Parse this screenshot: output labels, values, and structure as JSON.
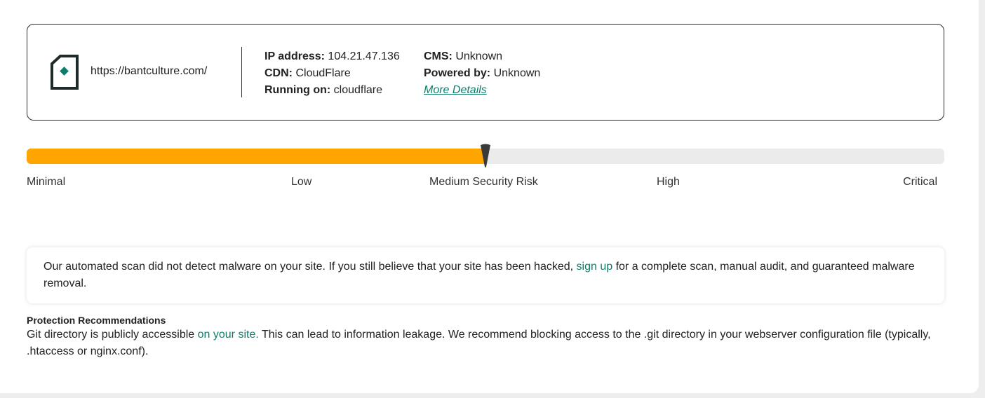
{
  "site": {
    "url": "https://bantculture.com/",
    "ip_label": "IP address:",
    "ip_value": "104.21.47.136",
    "cdn_label": "CDN:",
    "cdn_value": "CloudFlare",
    "running_label": "Running on:",
    "running_value": "cloudflare",
    "cms_label": "CMS:",
    "cms_value": "Unknown",
    "powered_label": "Powered by:",
    "powered_value": "Unknown",
    "more_details": "More Details",
    "icon": "site-page-icon"
  },
  "risk": {
    "level_fraction": 0.5,
    "fill_color": "#ffa500",
    "labels": [
      "Minimal",
      "Low",
      "Medium Security Risk",
      "High",
      "Critical"
    ]
  },
  "notice": {
    "text_before": "Our automated scan did not detect malware on your site. If you still believe that your site has been hacked, ",
    "link": "sign up",
    "text_after": " for a complete scan, manual audit, and guaranteed malware removal."
  },
  "recommendations": {
    "title": "Protection Recommendations",
    "text_before": "Git directory is publicly accessible ",
    "link": "on your site.",
    "text_after": " This can lead to information leakage. We recommend blocking access to the .git directory in your webserver configuration file (typically, .htaccess or nginx.conf)."
  },
  "colors": {
    "accent": "#0e7e6b",
    "risk_fill": "#ffa500",
    "track": "#ebebeb"
  }
}
